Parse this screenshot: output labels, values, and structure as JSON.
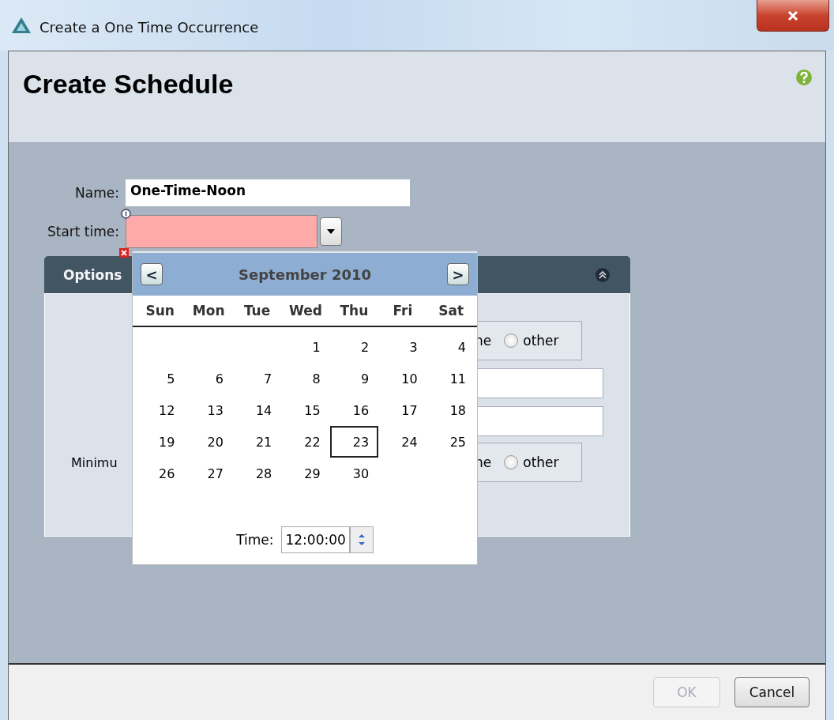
{
  "window": {
    "title": "Create a One Time Occurrence"
  },
  "dialog": {
    "heading": "Create Schedule"
  },
  "form": {
    "name": {
      "label": "Name:",
      "value": "One-Time-Noon"
    },
    "start_time": {
      "label": "Start time:",
      "invalid": true
    }
  },
  "options_panel": {
    "title": "Options",
    "expanded": true,
    "rows": [
      {
        "kind": "radio",
        "partial_text": "ne",
        "options": [
          {
            "label": "other",
            "selected": false
          }
        ]
      },
      {
        "kind": "field"
      },
      {
        "kind": "field"
      },
      {
        "kind": "radio",
        "label": "Minimu",
        "partial_text": "ne",
        "options": [
          {
            "label": "other",
            "selected": false
          }
        ]
      }
    ]
  },
  "calendar": {
    "month": "September 2010",
    "prev": "<",
    "next": ">",
    "weekdays": [
      "Sun",
      "Mon",
      "Tue",
      "Wed",
      "Thu",
      "Fri",
      "Sat"
    ],
    "weeks": [
      {
        "starts_midweek": true,
        "days": [
          {
            "label": "1",
            "selected": false
          },
          {
            "label": "2",
            "selected": false
          },
          {
            "label": "3",
            "selected": false
          },
          {
            "label": "4",
            "selected": false
          }
        ]
      },
      {
        "days": [
          {
            "label": "5",
            "selected": false
          },
          {
            "label": "6",
            "selected": false
          },
          {
            "label": "7",
            "selected": false
          },
          {
            "label": "8",
            "selected": false
          },
          {
            "label": "9",
            "selected": false
          },
          {
            "label": "10",
            "selected": false
          },
          {
            "label": "11",
            "selected": false
          }
        ]
      },
      {
        "days": [
          {
            "label": "12",
            "selected": false
          },
          {
            "label": "13",
            "selected": false
          },
          {
            "label": "14",
            "selected": false
          },
          {
            "label": "15",
            "selected": false
          },
          {
            "label": "16",
            "selected": false
          },
          {
            "label": "17",
            "selected": false
          },
          {
            "label": "18",
            "selected": false
          }
        ]
      },
      {
        "days": [
          {
            "label": "19",
            "selected": false
          },
          {
            "label": "20",
            "selected": false
          },
          {
            "label": "21",
            "selected": false
          },
          {
            "label": "22",
            "selected": false
          },
          {
            "label": "23",
            "selected": true
          },
          {
            "label": "24",
            "selected": false
          },
          {
            "label": "25",
            "selected": false
          }
        ]
      },
      {
        "starts_midweek": false,
        "days": [
          {
            "label": "26",
            "selected": false
          },
          {
            "label": "27",
            "selected": false
          },
          {
            "label": "28",
            "selected": false
          },
          {
            "label": "29",
            "selected": false
          },
          {
            "label": "30",
            "selected": false
          }
        ]
      }
    ],
    "time": {
      "label": "Time:",
      "value": "12:00:00"
    }
  },
  "buttons": [
    {
      "label": "OK",
      "disabled": true
    },
    {
      "label": "Cancel",
      "disabled": false
    }
  ]
}
